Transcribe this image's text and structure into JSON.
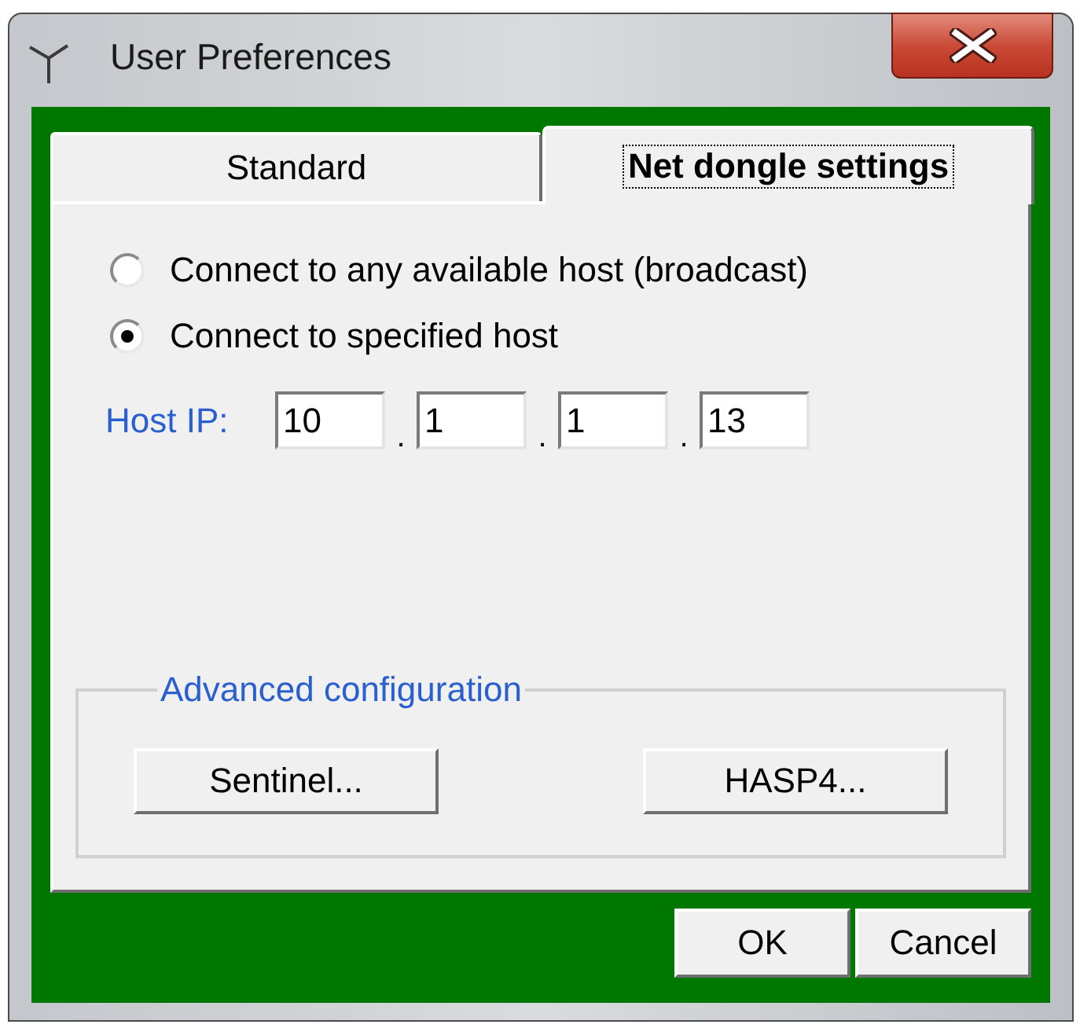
{
  "window": {
    "title": "User Preferences"
  },
  "tabs": [
    {
      "label": "Standard",
      "selected": false
    },
    {
      "label": "Net dongle settings",
      "selected": true
    }
  ],
  "connection_options": [
    {
      "label": "Connect to any available host (broadcast)",
      "selected": false
    },
    {
      "label": "Connect to specified host",
      "selected": true
    }
  ],
  "host_ip": {
    "label": "Host IP:",
    "octets": [
      "10",
      "1",
      "1",
      "13"
    ],
    "separators": [
      ".",
      ".",
      "."
    ]
  },
  "advanced_configuration": {
    "title": "Advanced configuration",
    "buttons": [
      "Sentinel...",
      "HASP4..."
    ]
  },
  "buttons": [
    "OK",
    "Cancel"
  ]
}
